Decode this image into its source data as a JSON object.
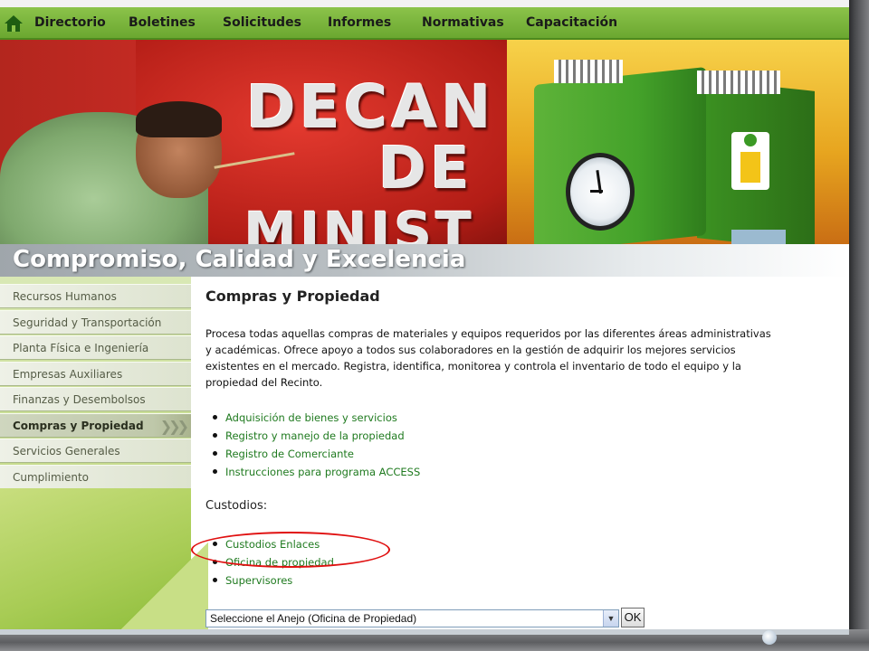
{
  "nav": {
    "items": [
      "Directorio",
      "Boletines",
      "Solicitudes",
      "Informes",
      "Normativas",
      "Capacitación"
    ]
  },
  "banner": {
    "letters_line1": "DECAN",
    "letters_line2": "DE",
    "letters_line3": "MINIST"
  },
  "tagline": "Compromiso, Calidad y Excelencia",
  "sidebar": {
    "items": [
      "Recursos Humanos",
      "Seguridad y Transportación",
      "Planta Física e Ingeniería",
      "Empresas Auxiliares",
      "Finanzas y Desembolsos",
      "Compras y Propiedad",
      "Servicios Generales",
      "Cumplimiento"
    ],
    "active_index": 5
  },
  "main": {
    "title": "Compras y Propiedad",
    "paragraph_lines": [
      "Procesa todas aquellas compras de materiales y equipos requeridos por las diferentes áreas administrativas",
      "y académicas.  Ofrece apoyo a todos sus colaboradores en la gestión de adquirir los mejores servicios",
      "existentes en el mercado.  Registra, identifica, monitorea y controla el inventario de todo el equipo y la",
      "propiedad del Recinto."
    ],
    "links": [
      "Adquisición de bienes y servicios",
      "Registro y manejo de la propiedad",
      "Registro de Comerciante",
      "Instrucciones para programa ACCESS"
    ],
    "custodios_label": "Custodios:",
    "custodios_links": [
      "Custodios Enlaces",
      "Oficina de propiedad",
      "Supervisores"
    ],
    "select_value": "Seleccione el Anejo (Oficina de Propiedad)",
    "ok_label": "OK"
  },
  "colors": {
    "nav_green": "#6ba730",
    "link_green": "#1f7a1f",
    "highlight_red": "#e01010"
  }
}
